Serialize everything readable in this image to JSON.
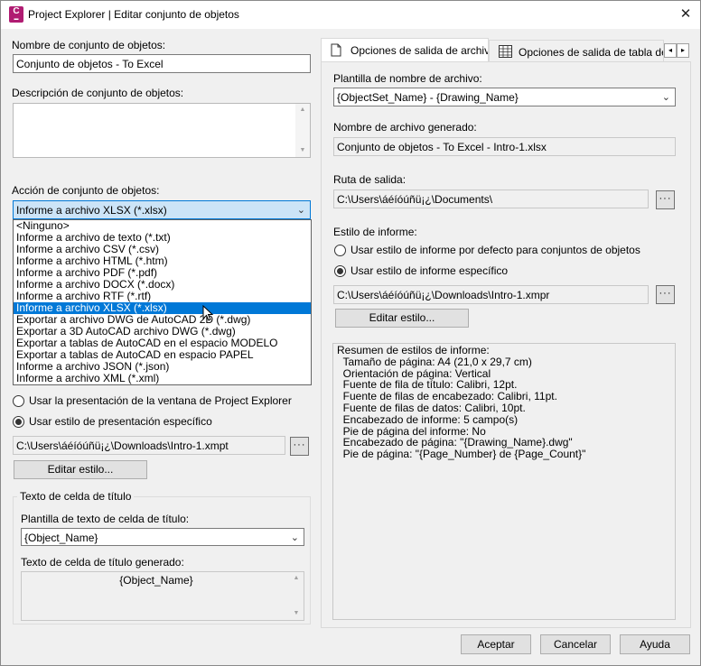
{
  "window": {
    "title": "Project Explorer | Editar conjunto de objetos",
    "close": "✕"
  },
  "left": {
    "name_label": "Nombre de conjunto de objetos:",
    "name_value": "Conjunto de objetos - To Excel",
    "desc_label": "Descripción de conjunto de objetos:",
    "action_label": "Acción de conjunto de objetos:",
    "action_value": "Informe a archivo XLSX (*.xlsx)",
    "action_options": [
      "<Ninguno>",
      "Informe a archivo de texto (*.txt)",
      "Informe a archivo CSV (*.csv)",
      "Informe a archivo HTML (*.htm)",
      "Informe a archivo PDF (*.pdf)",
      "Informe a archivo DOCX (*.docx)",
      "Informe a archivo RTF (*.rtf)",
      "Informe a archivo XLSX (*.xlsx)",
      "Exportar a archivo DWG de AutoCAD 2D (*.dwg)",
      "Exportar a 3D AutoCAD archivo DWG (*.dwg)",
      "Exportar a tablas de AutoCAD en el espacio MODELO",
      "Exportar a tablas de AutoCAD en espacio PAPEL",
      "Informe a archivo JSON (*.json)",
      "Informe a archivo XML (*.xml)"
    ],
    "selected_option_index": 7,
    "radio_window_layout": "Usar la presentación de la ventana de Project Explorer",
    "radio_specific_layout": "Usar estilo de presentación específico",
    "layout_path": "C:\\Users\\áéíóúñü¡¿\\Downloads\\Intro-1.xmpt",
    "edit_style_button": "Editar estilo...",
    "title_cell_group": "Texto de celda de título",
    "title_template_label": "Plantilla de texto de celda de título:",
    "title_template_value": "{Object_Name}",
    "title_generated_label": "Texto de celda de título generado:",
    "title_generated_value": "{Object_Name}"
  },
  "tabs": {
    "file_output": "Opciones de salida de archivo",
    "table_output": "Opciones de salida de tabla de A",
    "scroll_left": "◂",
    "scroll_right": "▸"
  },
  "right": {
    "template_label": "Plantilla de nombre de archivo:",
    "template_value": "{ObjectSet_Name} - {Drawing_Name}",
    "generated_label": "Nombre de archivo generado:",
    "generated_value": "Conjunto de objetos - To Excel - Intro-1.xlsx",
    "output_label": "Ruta de salida:",
    "output_value": "C:\\Users\\áéíóúñü¡¿\\Documents\\",
    "report_style_label": "Estilo de informe:",
    "radio_default_style": "Usar estilo de informe por defecto para conjuntos de objetos",
    "radio_specific_style": "Usar estilo de informe específico",
    "style_path": "C:\\Users\\áéíóúñü¡¿\\Downloads\\Intro-1.xmpr",
    "edit_style_button": "Editar estilo...",
    "summary_lines": [
      "Resumen de estilos de informe:",
      "  Tamaño de página: A4 (21,0 x 29,7 cm)",
      "  Orientación de página: Vertical",
      "  Fuente de fila de título: Calibri, 12pt.",
      "  Fuente de filas de encabezado: Calibri, 11pt.",
      "  Fuente de filas de datos: Calibri, 10pt.",
      "  Encabezado de informe: 5 campo(s)",
      "  Pie de página del informe: No",
      "  Encabezado de página: \"{Drawing_Name}.dwg\"",
      "  Pie de página: \"{Page_Number} de {Page_Count}\""
    ]
  },
  "footer": {
    "accept": "Aceptar",
    "cancel": "Cancelar",
    "help": "Ayuda"
  },
  "icons": {
    "dots": "···",
    "chevron": "⌄"
  }
}
